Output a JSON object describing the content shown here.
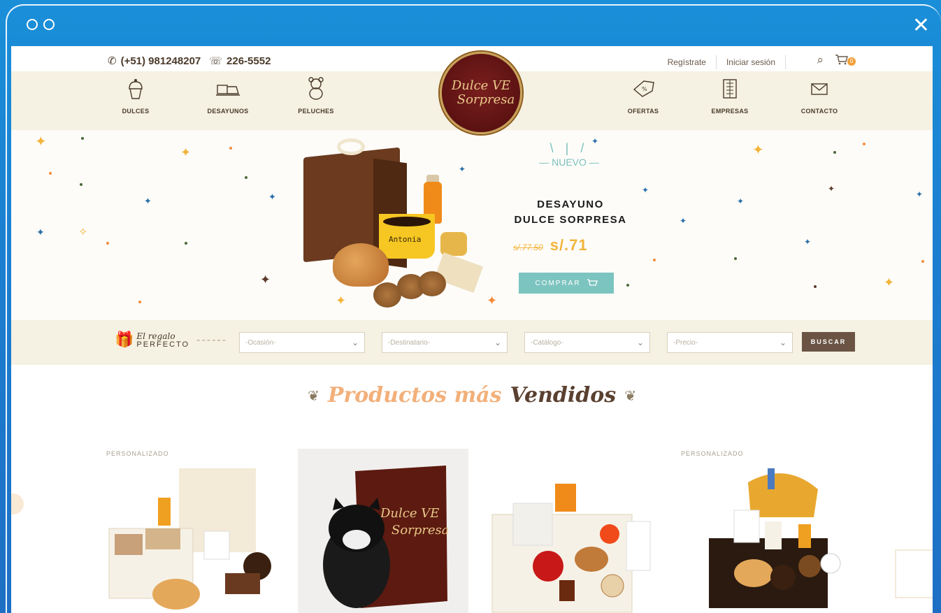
{
  "window": {
    "close_glyph": "✕"
  },
  "topbar": {
    "whatsapp": "(+51) 981248207",
    "phone": "226-5552",
    "register": "Regístrate",
    "login": "Iniciar sesión",
    "cart_count": "0"
  },
  "nav": {
    "left": [
      {
        "label": "DULCES",
        "icon": "cupcake-icon"
      },
      {
        "label": "DESAYUNOS",
        "icon": "breakfast-tray-icon"
      },
      {
        "label": "PELUCHES",
        "icon": "teddy-bear-icon"
      }
    ],
    "right": [
      {
        "label": "OFERTAS",
        "icon": "discount-tag-icon"
      },
      {
        "label": "EMPRESAS",
        "icon": "building-icon"
      },
      {
        "label": "CONTACTO",
        "icon": "envelope-icon"
      }
    ]
  },
  "logo": {
    "line1": "Dulce VE",
    "line2": "Sorpresa"
  },
  "hero": {
    "badge": "NUEVO",
    "title_line1": "DESAYUNO",
    "title_line2": "DULCE SORPRESA",
    "old_price": "s/.77.50",
    "new_price": "s/.71",
    "button": "COMPRAR",
    "mug_text": "Antonia"
  },
  "finder": {
    "title_script": "El regalo",
    "title_caps": "PERFECTO",
    "selects": [
      "-Ocasión-",
      "-Destinatario-",
      "-Catálogo-",
      "-Precio-"
    ],
    "button": "BUSCAR"
  },
  "section": {
    "title_part1": "Productos más",
    "title_part2": "Vendidos"
  },
  "products": [
    {
      "tag": "PERSONALIZADO"
    },
    {
      "tag": ""
    },
    {
      "tag": ""
    },
    {
      "tag": "PERSONALIZADO"
    }
  ],
  "colors": {
    "accent_teal": "#7cc4c0",
    "price_gold": "#f2b43a",
    "nav_band": "#f5f1e3",
    "logo_maroon": "#5c1212",
    "search_button": "#6b5444"
  }
}
